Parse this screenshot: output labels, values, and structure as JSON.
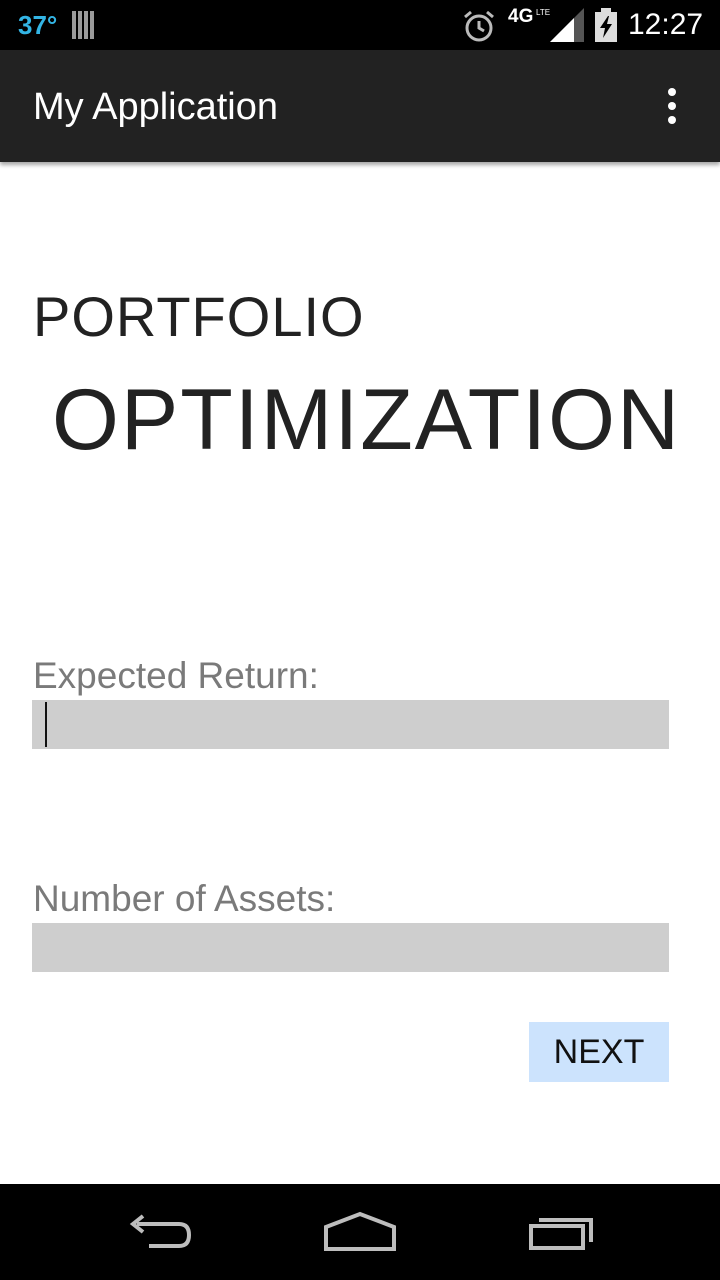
{
  "status_bar": {
    "temperature": "37°",
    "network": "4G",
    "network_sub": "LTE",
    "time": "12:27",
    "icons": [
      "storage-bars-icon",
      "alarm-icon",
      "signal-icon",
      "battery-icon"
    ]
  },
  "action_bar": {
    "title": "My Application",
    "overflow_icon": "overflow-menu-icon"
  },
  "header": {
    "line1": "PORTFOLIO",
    "line2": "OPTIMIZATION"
  },
  "form": {
    "expected_return": {
      "label": "Expected Return:",
      "value": ""
    },
    "number_of_assets": {
      "label": "Number of Assets:",
      "value": ""
    },
    "next_label": "NEXT"
  },
  "nav_bar": {
    "icons": [
      "back-icon",
      "home-icon",
      "recents-icon"
    ]
  },
  "colors": {
    "status_temp": "#33b5e5",
    "action_bar": "#222222",
    "field_bg": "#cecece",
    "button_bg": "#cce3fd",
    "label": "#7a7a7a"
  }
}
